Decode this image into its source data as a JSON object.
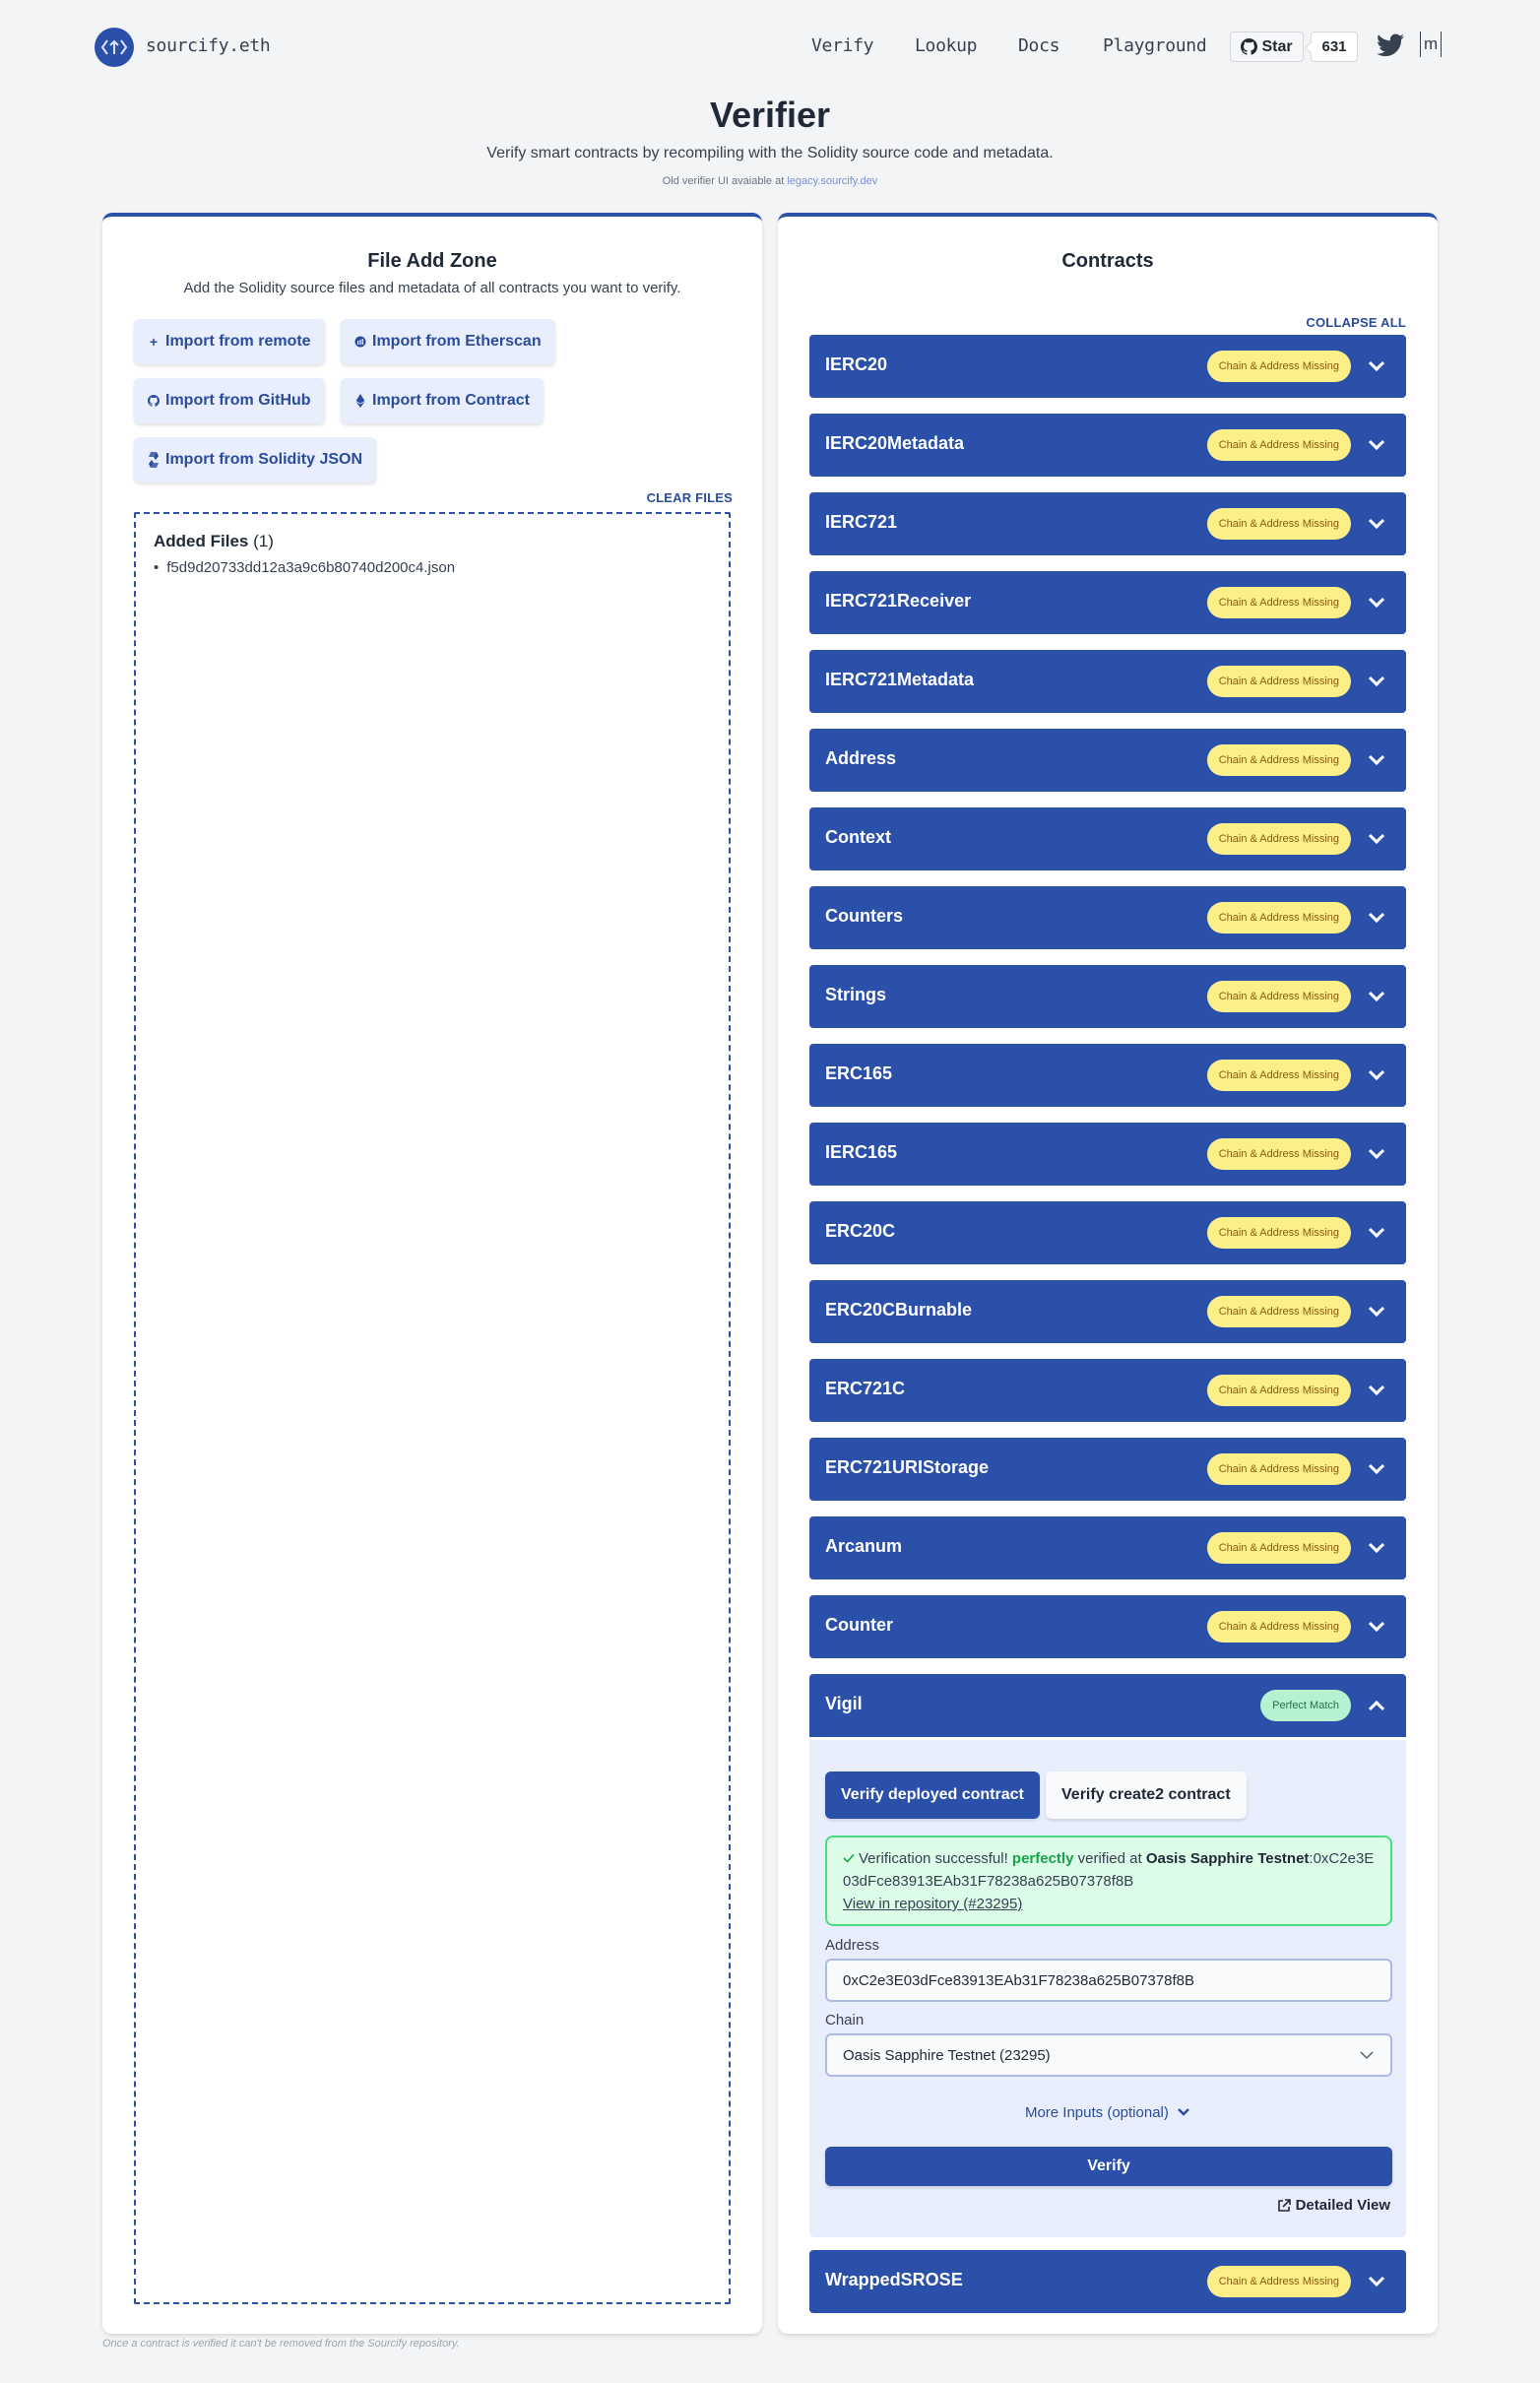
{
  "header": {
    "brand": "sourcify.eth",
    "nav": [
      "Verify",
      "Lookup",
      "Docs",
      "Playground"
    ],
    "github_star_label": "Star",
    "github_star_count": "631",
    "matrix_label": "m"
  },
  "hero": {
    "title": "Verifier",
    "subtitle": "Verify smart contracts by recompiling with the Solidity source code and metadata.",
    "legacy_text": "Old verifier UI avaiable at ",
    "legacy_link": "legacy.sourcify.dev"
  },
  "file_zone": {
    "title": "File Add Zone",
    "description": "Add the Solidity source files and metadata of all contracts you want to verify.",
    "import_buttons": [
      {
        "label": "Import from remote",
        "icon": "plus-icon"
      },
      {
        "label": "Import from Etherscan",
        "icon": "etherscan-icon"
      },
      {
        "label": "Import from GitHub",
        "icon": "github-icon"
      },
      {
        "label": "Import from Contract",
        "icon": "ethereum-icon"
      },
      {
        "label": "Import from Solidity JSON",
        "icon": "solidity-icon"
      }
    ],
    "clear_files": "CLEAR FILES",
    "added_files_label": "Added Files",
    "added_files_count": "(1)",
    "files": [
      "f5d9d20733dd12a3a9c6b80740d200c4.json"
    ],
    "footer_note": "Once a contract is verified it can't be removed from the Sourcify repository."
  },
  "contracts_panel": {
    "title": "Contracts",
    "collapse_all": "COLLAPSE ALL",
    "status_colors": {
      "missing_bg": "#fdef87",
      "perfect_bg": "#b6f2cf",
      "header_bg": "#2b50aa"
    },
    "contracts": [
      {
        "name": "IERC20",
        "status": "Chain & Address Missing"
      },
      {
        "name": "IERC20Metadata",
        "status": "Chain & Address Missing"
      },
      {
        "name": "IERC721",
        "status": "Chain & Address Missing"
      },
      {
        "name": "IERC721Receiver",
        "status": "Chain & Address Missing"
      },
      {
        "name": "IERC721Metadata",
        "status": "Chain & Address Missing"
      },
      {
        "name": "Address",
        "status": "Chain & Address Missing"
      },
      {
        "name": "Context",
        "status": "Chain & Address Missing"
      },
      {
        "name": "Counters",
        "status": "Chain & Address Missing"
      },
      {
        "name": "Strings",
        "status": "Chain & Address Missing"
      },
      {
        "name": "ERC165",
        "status": "Chain & Address Missing"
      },
      {
        "name": "IERC165",
        "status": "Chain & Address Missing"
      },
      {
        "name": "ERC20C",
        "status": "Chain & Address Missing"
      },
      {
        "name": "ERC20CBurnable",
        "status": "Chain & Address Missing"
      },
      {
        "name": "ERC721C",
        "status": "Chain & Address Missing"
      },
      {
        "name": "ERC721URIStorage",
        "status": "Chain & Address Missing"
      },
      {
        "name": "Arcanum",
        "status": "Chain & Address Missing"
      },
      {
        "name": "Counter",
        "status": "Chain & Address Missing"
      },
      {
        "name": "Vigil",
        "status": "Perfect Match",
        "expanded": true
      },
      {
        "name": "WrappedSROSE",
        "status": "Chain & Address Missing"
      }
    ],
    "expanded": {
      "tab_deployed": "Verify deployed contract",
      "tab_create2": "Verify create2 contract",
      "success_prefix": "Verification successful! ",
      "success_match": "perfectly",
      "success_mid": " verified at ",
      "success_chain": "Oasis Sapphire Testnet",
      "success_address": ":0xC2e3E03dFce83913EAb31F78238a625B07378f8B",
      "repo_link": "View in repository (#23295)",
      "address_label": "Address",
      "address_value": "0xC2e3E03dFce83913EAb31F78238a625B07378f8B",
      "chain_label": "Chain",
      "chain_value": "Oasis Sapphire Testnet (23295)",
      "more_inputs": "More Inputs (optional)",
      "verify_button": "Verify",
      "detailed_view": "Detailed View"
    }
  }
}
